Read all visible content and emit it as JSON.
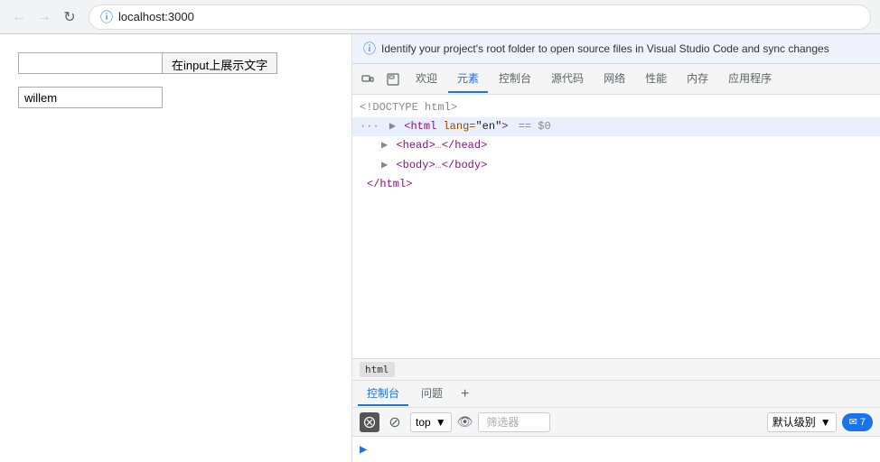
{
  "browser": {
    "back_disabled": true,
    "forward_disabled": true,
    "url": "localhost:3000"
  },
  "page": {
    "input_placeholder": "",
    "input_value": "willem",
    "show_button_label": "在input上展示文字"
  },
  "devtools": {
    "info_bar_text": "Identify your project's root folder to open source files in Visual Studio Code and sync changes",
    "tabs": [
      "欢迎",
      "元素",
      "控制台",
      "源代码",
      "网络",
      "性能",
      "内存",
      "应用程序"
    ],
    "active_tab": "元素",
    "elements": {
      "doctype": "<!DOCTYPE html>",
      "html_tag": "<html lang=\"en\">",
      "html_attr": "== $0",
      "head_collapsed": "<head>…</head>",
      "body_collapsed": "<body>…</body>",
      "close_html": "</html>"
    },
    "breadcrumb": "html",
    "console": {
      "tabs": [
        "控制台",
        "问题"
      ],
      "active_tab": "控制台",
      "top_label": "top",
      "filter_placeholder": "筛选器",
      "level_label": "默认级别",
      "badge_count": "7"
    }
  }
}
